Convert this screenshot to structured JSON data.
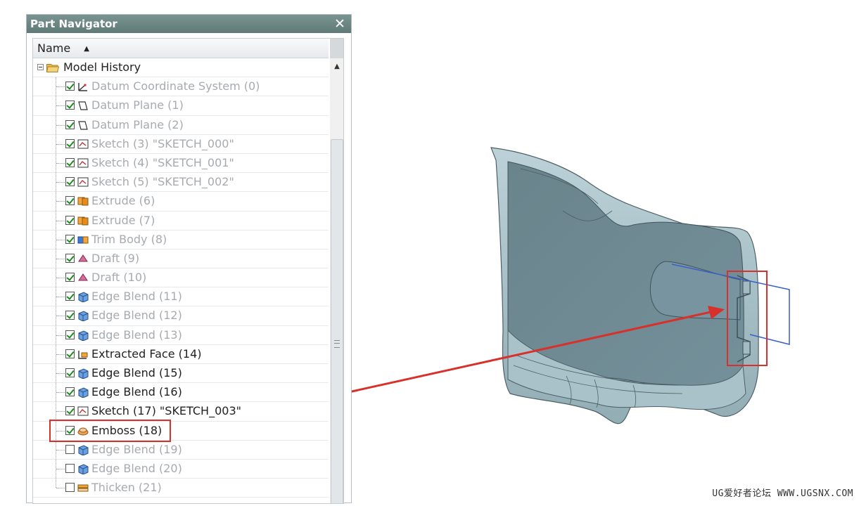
{
  "panel": {
    "title": "Part Navigator",
    "close_glyph": "✕",
    "column_header": "Name",
    "sort_glyph": "▲"
  },
  "tree": {
    "root_label": "Model History",
    "root_icon": "folder-open-icon",
    "features": [
      {
        "label": "Datum Coordinate System (0)",
        "checked": true,
        "icon": "datum-csys-icon",
        "active": false
      },
      {
        "label": "Datum Plane (1)",
        "checked": true,
        "icon": "datum-plane-icon",
        "active": false
      },
      {
        "label": "Datum Plane (2)",
        "checked": true,
        "icon": "datum-plane-icon",
        "active": false
      },
      {
        "label": "Sketch (3) \"SKETCH_000\"",
        "checked": true,
        "icon": "sketch-icon",
        "active": false
      },
      {
        "label": "Sketch (4) \"SKETCH_001\"",
        "checked": true,
        "icon": "sketch-icon",
        "active": false
      },
      {
        "label": "Sketch (5) \"SKETCH_002\"",
        "checked": true,
        "icon": "sketch-icon",
        "active": false
      },
      {
        "label": "Extrude (6)",
        "checked": true,
        "icon": "extrude-icon",
        "active": false
      },
      {
        "label": "Extrude (7)",
        "checked": true,
        "icon": "extrude-icon",
        "active": false
      },
      {
        "label": "Trim Body (8)",
        "checked": true,
        "icon": "trim-body-icon",
        "active": false
      },
      {
        "label": "Draft (9)",
        "checked": true,
        "icon": "draft-icon",
        "active": false
      },
      {
        "label": "Draft (10)",
        "checked": true,
        "icon": "draft-icon",
        "active": false
      },
      {
        "label": "Edge Blend (11)",
        "checked": true,
        "icon": "edge-blend-icon",
        "active": false
      },
      {
        "label": "Edge Blend (12)",
        "checked": true,
        "icon": "edge-blend-icon",
        "active": false
      },
      {
        "label": "Edge Blend (13)",
        "checked": true,
        "icon": "edge-blend-icon",
        "active": false
      },
      {
        "label": "Extracted Face (14)",
        "checked": true,
        "icon": "extracted-face-icon",
        "active": true
      },
      {
        "label": "Edge Blend (15)",
        "checked": true,
        "icon": "edge-blend-icon",
        "active": true
      },
      {
        "label": "Edge Blend (16)",
        "checked": true,
        "icon": "edge-blend-icon",
        "active": true
      },
      {
        "label": "Sketch (17) \"SKETCH_003\"",
        "checked": true,
        "icon": "sketch-icon",
        "active": true
      },
      {
        "label": "Emboss (18)",
        "checked": true,
        "icon": "emboss-icon",
        "active": true
      },
      {
        "label": "Edge Blend (19)",
        "checked": false,
        "icon": "edge-blend-icon",
        "active": false
      },
      {
        "label": "Edge Blend (20)",
        "checked": false,
        "icon": "edge-blend-icon",
        "active": false
      },
      {
        "label": "Thicken (21)",
        "checked": false,
        "icon": "thicken-icon",
        "active": false
      }
    ]
  },
  "annotation": {
    "color": "#d8302a",
    "highlighted_feature": "Emboss (18)"
  },
  "viewport": {
    "model_color": "#6f8a92",
    "watermark": "UG爱好者论坛 WWW.UGSNX.COM"
  }
}
